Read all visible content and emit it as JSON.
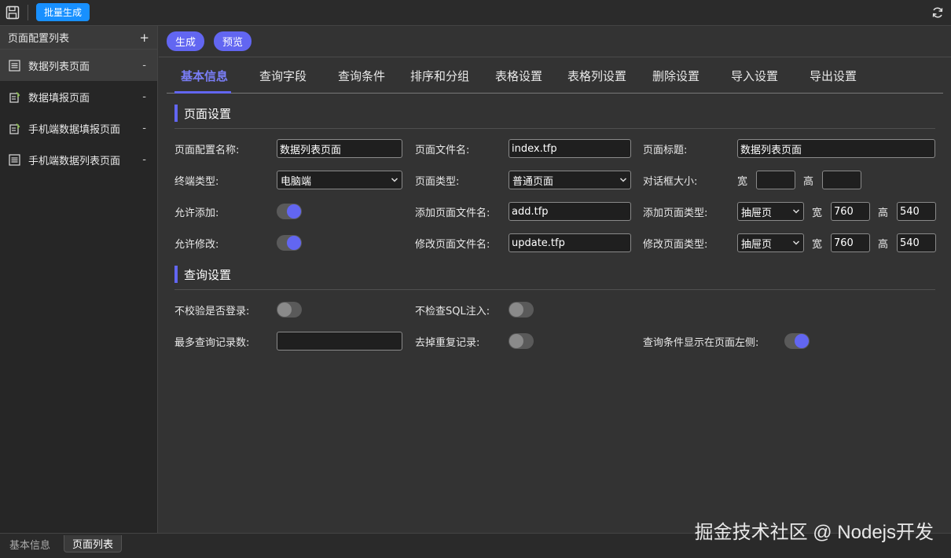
{
  "toolbar": {
    "batch_generate": "批量生成",
    "save_icon": "save-icon",
    "refresh_icon": "refresh-icon"
  },
  "sidebar": {
    "title": "页面配置列表",
    "add": "+",
    "items": [
      {
        "label": "数据列表页面",
        "icon": "list-page-icon",
        "active": true
      },
      {
        "label": "数据填报页面",
        "icon": "form-page-icon",
        "active": false
      },
      {
        "label": "手机端数据填报页面",
        "icon": "form-page-icon",
        "active": false
      },
      {
        "label": "手机端数据列表页面",
        "icon": "list-page-icon",
        "active": false
      }
    ],
    "remove": "-"
  },
  "bottom_tabs": [
    "基本信息",
    "页面列表"
  ],
  "watermark": "掘金技术社区 @ Nodejs开发",
  "actions": {
    "generate": "生成",
    "preview": "预览"
  },
  "tabs": [
    "基本信息",
    "查询字段",
    "查询条件",
    "排序和分组",
    "表格设置",
    "表格列设置",
    "删除设置",
    "导入设置",
    "导出设置"
  ],
  "page_settings": {
    "title": "页面设置",
    "config_name_label": "页面配置名称:",
    "config_name_value": "数据列表页面",
    "file_name_label": "页面文件名:",
    "file_name_value": "index.tfp",
    "page_title_label": "页面标题:",
    "page_title_value": "数据列表页面",
    "terminal_label": "终端类型:",
    "terminal_value": "电脑端",
    "page_type_label": "页面类型:",
    "page_type_value": "普通页面",
    "dialog_size_label": "对话框大小:",
    "width_label": "宽",
    "height_label": "高",
    "dialog_width": "",
    "dialog_height": "",
    "allow_add_label": "允许添加:",
    "allow_add": true,
    "add_file_label": "添加页面文件名:",
    "add_file_value": "add.tfp",
    "add_type_label": "添加页面类型:",
    "add_type_value": "抽屉页",
    "add_width": "760",
    "add_height": "540",
    "allow_edit_label": "允许修改:",
    "allow_edit": true,
    "edit_file_label": "修改页面文件名:",
    "edit_file_value": "update.tfp",
    "edit_type_label": "修改页面类型:",
    "edit_type_value": "抽屉页",
    "edit_width": "760",
    "edit_height": "540"
  },
  "query_settings": {
    "title": "查询设置",
    "no_login_label": "不校验是否登录:",
    "no_login": false,
    "no_sql_check_label": "不检查SQL注入:",
    "no_sql_check": false,
    "max_records_label": "最多查询记录数:",
    "max_records_value": "",
    "dedupe_label": "去掉重复记录:",
    "dedupe": false,
    "left_conditions_label": "查询条件显示在页面左侧:",
    "left_conditions": true
  },
  "colors": {
    "accent": "#6266f1",
    "primary_button": "#1890ff"
  }
}
